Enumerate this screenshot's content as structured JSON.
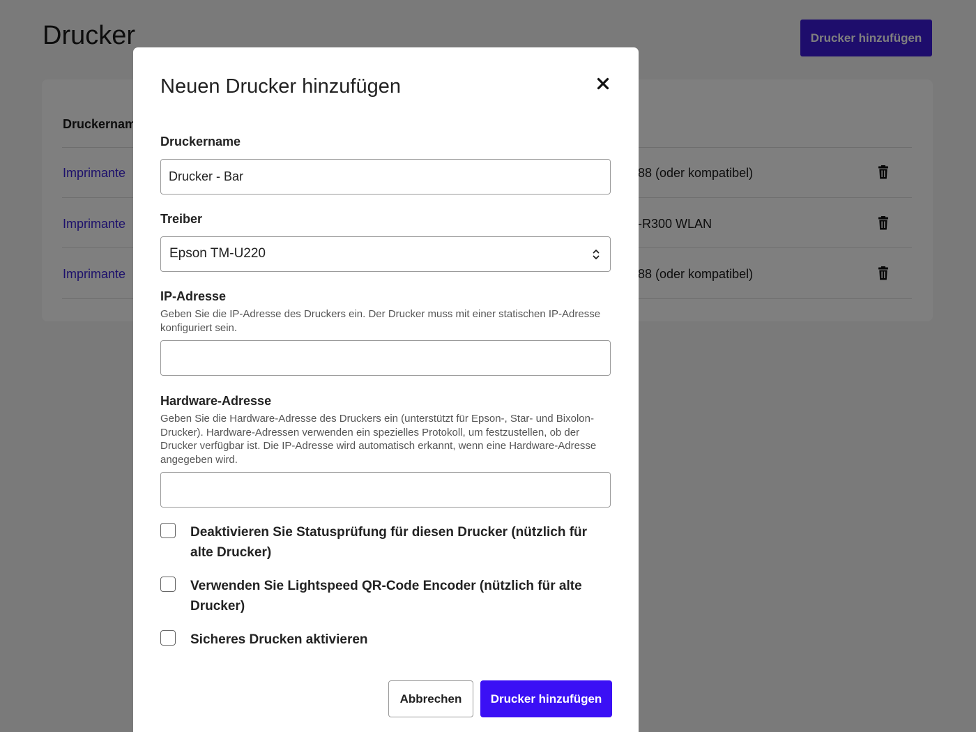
{
  "page": {
    "title": "Drucker",
    "add_button": "Drucker hinzufügen",
    "table": {
      "column_name": "Druckername",
      "rows": [
        {
          "name": "Imprimante",
          "driver": "88 (oder kompatibel)",
          "delete_icon": "trash-icon"
        },
        {
          "name": "Imprimante",
          "driver": "-R300 WLAN",
          "delete_icon": "trash-icon"
        },
        {
          "name": "Imprimante",
          "driver": "88 (oder kompatibel)",
          "delete_icon": "trash-icon"
        }
      ]
    }
  },
  "modal": {
    "title": "Neuen Drucker hinzufügen",
    "close_icon": "close-icon",
    "fields": {
      "name": {
        "label": "Druckername",
        "value": "Drucker - Bar"
      },
      "driver": {
        "label": "Treiber",
        "value": "Epson TM-U220"
      },
      "ip": {
        "label": "IP-Adresse",
        "help": "Geben Sie die IP-Adresse des Druckers ein. Der Drucker muss mit einer statischen IP-Adresse konfiguriert sein.",
        "value": ""
      },
      "hardware": {
        "label": "Hardware-Adresse",
        "help": "Geben Sie die Hardware-Adresse des Druckers ein (unterstützt für Epson-, Star- und Bixolon-Drucker). Hardware-Adressen verwenden ein spezielles Protokoll, um festzustellen, ob der Drucker verfügbar ist. Die IP-Adresse wird automatisch erkannt, wenn eine Hardware-Adresse angegeben wird.",
        "value": ""
      }
    },
    "checkboxes": [
      {
        "label": "Deaktivieren Sie Statusprüfung für diesen Drucker (nützlich für alte Drucker)",
        "checked": false
      },
      {
        "label": "Verwenden Sie Lightspeed QR-Code Encoder (nützlich für alte Drucker)",
        "checked": false
      },
      {
        "label": "Sicheres Drucken aktivieren",
        "checked": false
      }
    ],
    "buttons": {
      "cancel": "Abbrechen",
      "submit": "Drucker hinzufügen"
    }
  },
  "colors": {
    "primary": "#3b10f5",
    "link": "#3a22d6",
    "overlay": "rgba(0,0,0,0.5)"
  }
}
